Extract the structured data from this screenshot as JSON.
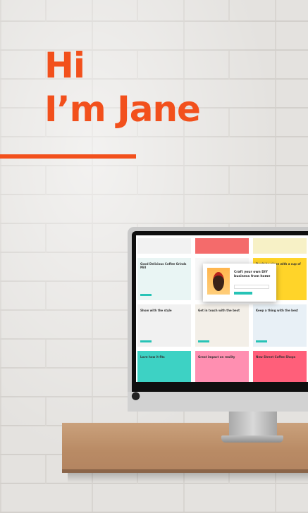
{
  "hero": {
    "line1": "Hi",
    "line2": "I’m Jane",
    "accent_color": "#f2501c"
  },
  "monitor": {
    "logo_icon": "apple-icon",
    "screen_tiles": [
      {
        "title": "",
        "bg": "#f2f2f2"
      },
      {
        "title": "",
        "bg": "#f46b6b"
      },
      {
        "title": "",
        "bg": "#f7f1c6"
      },
      {
        "title": "Good Delicious Coffee Grinds Mill",
        "bg": "#e9f5f4"
      },
      {
        "title": "",
        "bg": "#f7f7f7"
      },
      {
        "title": "Don’t be alone with a cup of coffee",
        "bg": "#ffd429"
      },
      {
        "title": "Show with the style",
        "bg": "#f1f1f1"
      },
      {
        "title": "Get in touch with the best",
        "bg": "#f3efe8"
      },
      {
        "title": "Keep a thing with the best",
        "bg": "#e8f0f6"
      },
      {
        "title": "Love how it fits",
        "bg": "#3dd2c4"
      },
      {
        "title": "Great impact on reality",
        "bg": "#ff8fb1"
      },
      {
        "title": "New Street Coffee Shops",
        "bg": "#ff5f7a"
      },
      {
        "title": "",
        "bg": "#ffffff"
      },
      {
        "title": "",
        "bg": "#f4f4f4"
      },
      {
        "title": "",
        "bg": "#2a2a2a"
      }
    ],
    "modal": {
      "title": "Craft your own DIY business from home"
    }
  }
}
